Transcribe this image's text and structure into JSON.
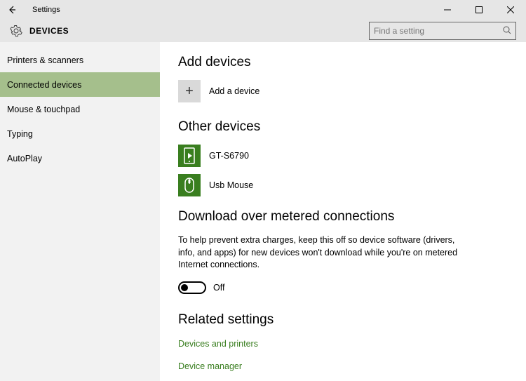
{
  "titlebar": {
    "title": "Settings"
  },
  "header": {
    "page_title": "DEVICES",
    "search_placeholder": "Find a setting"
  },
  "sidebar": {
    "items": [
      {
        "label": "Printers & scanners",
        "active": false
      },
      {
        "label": "Connected devices",
        "active": true
      },
      {
        "label": "Mouse & touchpad",
        "active": false
      },
      {
        "label": "Typing",
        "active": false
      },
      {
        "label": "AutoPlay",
        "active": false
      }
    ]
  },
  "main": {
    "add_devices": {
      "heading": "Add devices",
      "add_label": "Add a device"
    },
    "other_devices": {
      "heading": "Other devices",
      "devices": [
        {
          "name": "GT-S6790",
          "icon": "device-phone"
        },
        {
          "name": "Usb Mouse",
          "icon": "device-mouse"
        }
      ]
    },
    "metered": {
      "heading": "Download over metered connections",
      "description": "To help prevent extra charges, keep this off so device software (drivers, info, and apps) for new devices won't download while you're on metered Internet connections.",
      "toggle_state": "Off"
    },
    "related": {
      "heading": "Related settings",
      "links": [
        "Devices and printers",
        "Device manager"
      ]
    }
  }
}
